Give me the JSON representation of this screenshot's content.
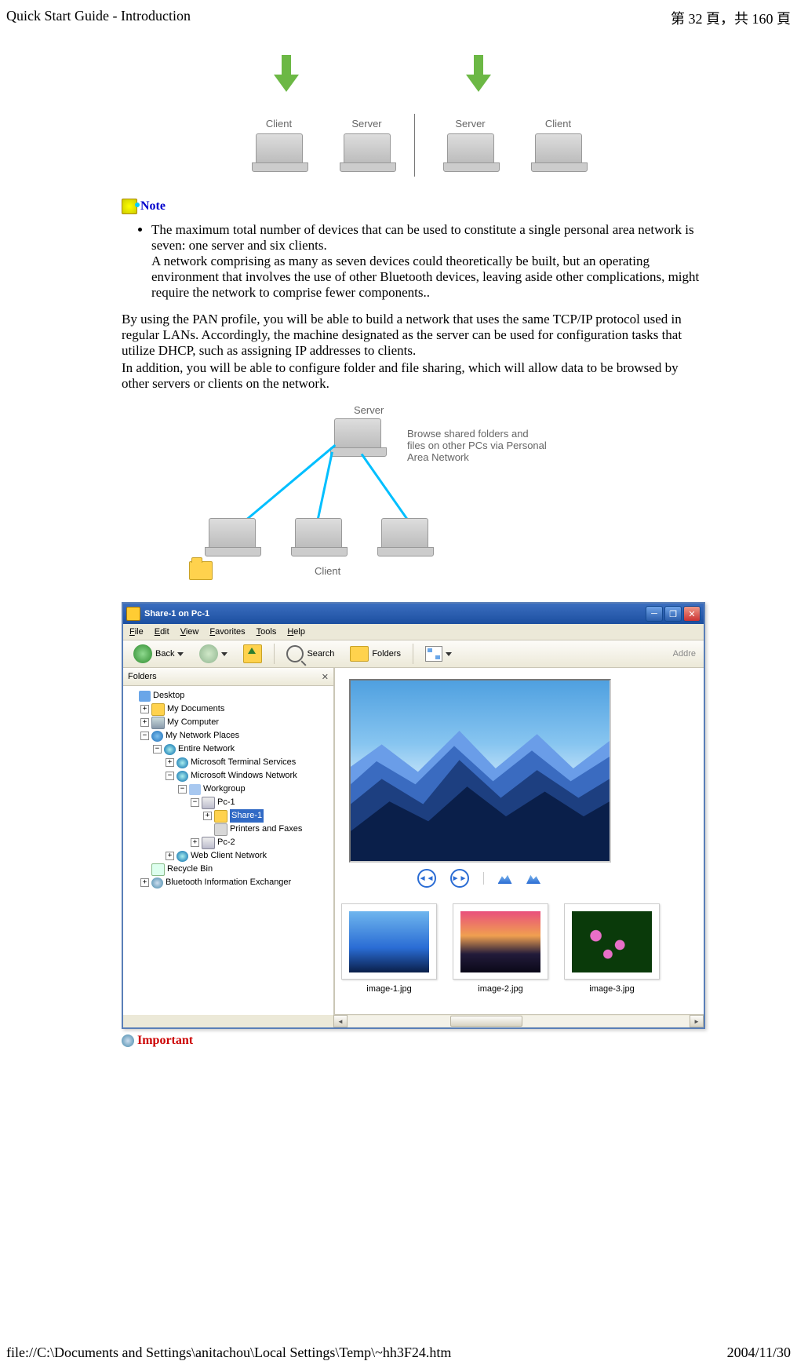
{
  "header": {
    "title": "Quick Start Guide - Introduction",
    "page_info_prefix": "第 ",
    "page_current": "32",
    "page_info_mid": " 頁，共 ",
    "page_total": "160",
    "page_info_suffix": " 頁"
  },
  "diagram1": {
    "labels": [
      "Client",
      "Server",
      "Server",
      "Client"
    ]
  },
  "note": {
    "label": "Note",
    "bullets": [
      "The maximum total number of devices that can be used to constitute a single personal area network is seven: one server and six clients.",
      "A network comprising as many as seven devices could theoretically be built, but an operating environment that involves the use of other Bluetooth devices, leaving aside other complications, might require the network to comprise fewer components.."
    ]
  },
  "paragraph": {
    "line1": "By using the PAN profile, you will be able to build a network that uses the same TCP/IP protocol used in regular LANs. Accordingly, the machine designated as the server can be used for configuration tasks that utilize DHCP, such as assigning IP addresses to clients.",
    "line2": "In addition, you will be able to configure folder and file sharing, which will allow data to be browsed by other servers or clients on the network."
  },
  "cjk_placeholder": "　　　　",
  "diagram2": {
    "server_label": "Server",
    "client_label": "Client",
    "desc": "Browse shared folders and files on other PCs via Personal Area Network"
  },
  "window": {
    "title": "Share-1 on Pc-1",
    "menus": [
      "File",
      "Edit",
      "View",
      "Favorites",
      "Tools",
      "Help"
    ],
    "toolbar": {
      "back": "Back",
      "search": "Search",
      "folders": "Folders",
      "address_stub": "Addre"
    },
    "folders_header": "Folders",
    "tree": {
      "desktop": "Desktop",
      "mydocs": "My Documents",
      "mycomp": "My Computer",
      "mynet": "My Network Places",
      "entire": "Entire Network",
      "mts": "Microsoft Terminal Services",
      "mwn": "Microsoft Windows Network",
      "workgroup": "Workgroup",
      "pc1": "Pc-1",
      "share1": "Share-1",
      "printers": "Printers and Faxes",
      "pc2": "Pc-2",
      "webclient": "Web Client Network",
      "recycle": "Recycle Bin",
      "btx": "Bluetooth Information Exchanger"
    },
    "controls": {
      "prev": "◄◄",
      "next": "►►"
    },
    "thumbs": [
      "image-1.jpg",
      "image-2.jpg",
      "image-3.jpg"
    ]
  },
  "important": {
    "label": "Important"
  },
  "footer": {
    "path": "file://C:\\Documents and Settings\\anitachou\\Local Settings\\Temp\\~hh3F24.htm",
    "date": "2004/11/30"
  }
}
